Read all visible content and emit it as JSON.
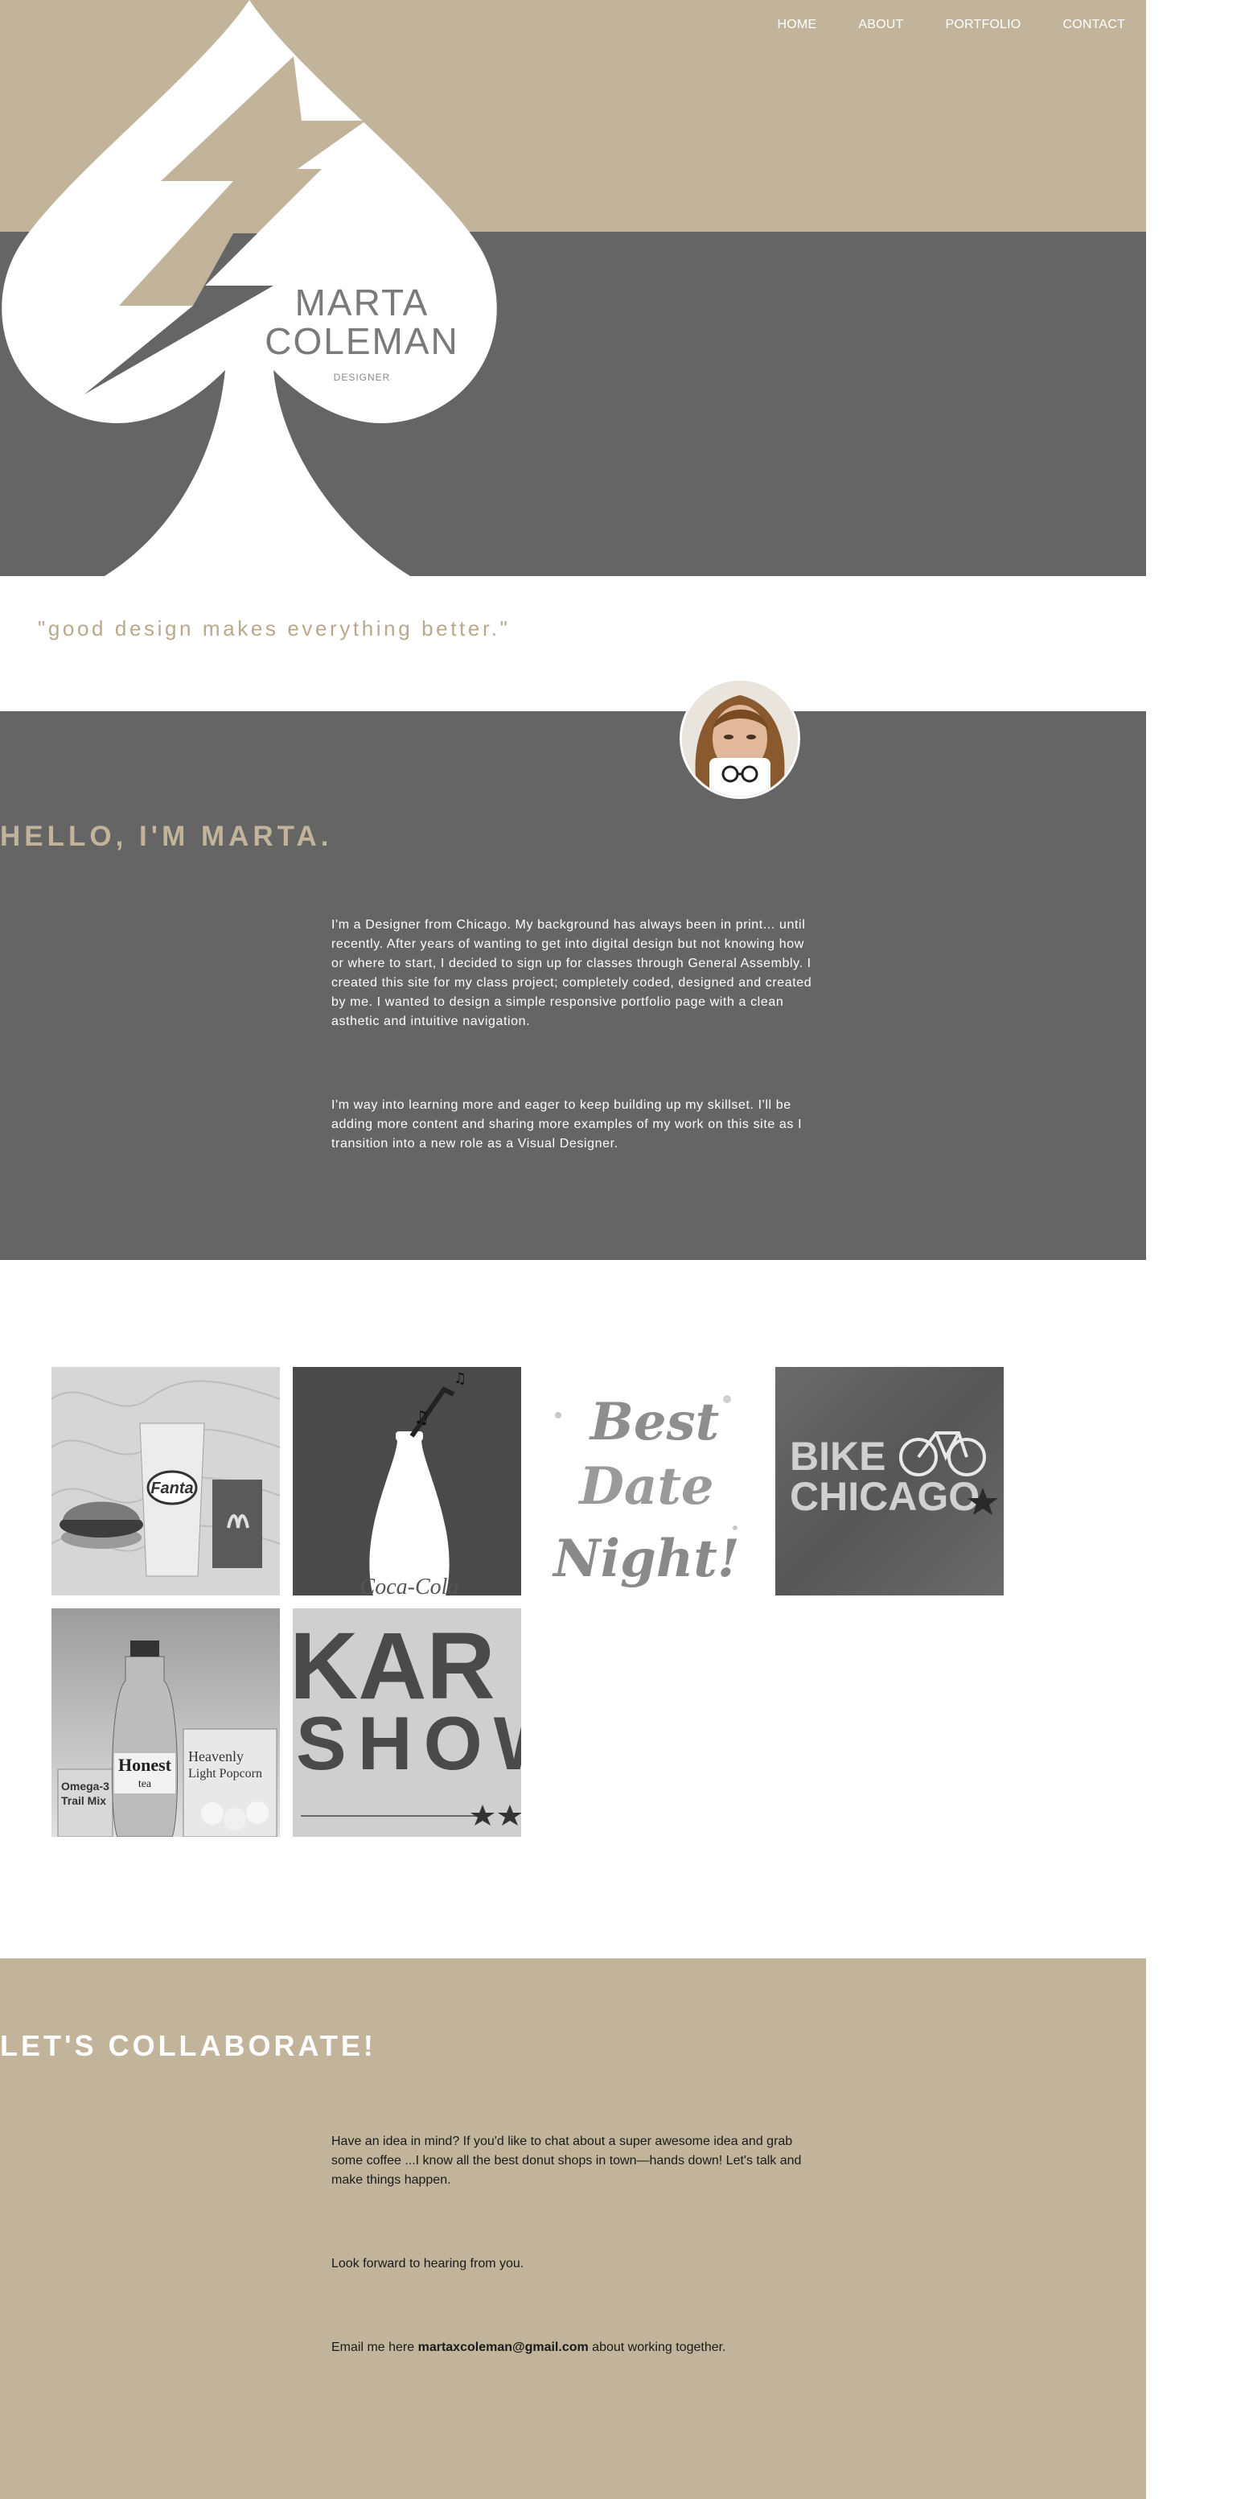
{
  "nav": {
    "items": [
      {
        "label": "HOME"
      },
      {
        "label": "ABOUT"
      },
      {
        "label": "PORTFOLIO"
      },
      {
        "label": "CONTACT"
      }
    ]
  },
  "hero": {
    "name_line1": "MARTA",
    "name_line2": "COLEMAN",
    "role": "DESIGNER",
    "colors": {
      "tan": "#c2b49a",
      "gray": "#656565"
    }
  },
  "quote": "\"good design makes everything better.\"",
  "about": {
    "title": "HELLO, I'M MARTA.",
    "paragraph1": "I'm a Designer from Chicago. My background has always been in print... until recently. After years of wanting to get into digital design but not knowing how or where to start, I decided to sign up for classes through General Assembly. I created this site for my class project; completely coded, designed and created by me. I wanted to design a simple responsive portfolio page with a clean asthetic and intuitive navigation.",
    "paragraph2": "I'm way into learning more and eager to keep building up my skillset. I'll be adding more content and sharing more examples of my work on this site as I transition into a new role as a Visual Designer."
  },
  "portfolio": {
    "tiles": [
      {
        "icon": "fast-food-image",
        "text": "Fanta"
      },
      {
        "icon": "coca-cola-bottle-image",
        "text": "Coca-Cola"
      },
      {
        "icon": "best-date-night-image",
        "text_line1": "Best",
        "text_line2": "Date",
        "text_line3": "Night!"
      },
      {
        "icon": "bike-chicago-image",
        "text_line1": "BIKE",
        "text_line2": "CHICAGO"
      },
      {
        "icon": "snacks-image",
        "text_line1": "Honest",
        "text_line2": "tea",
        "text_line3": "Heavenly",
        "text_line4": "Light Popcorn",
        "text_line5": "Omega-3",
        "text_line6": "Trail Mix"
      },
      {
        "icon": "karaoke-show-image",
        "text_line1": "KAR",
        "text_line2": "SHOW"
      }
    ]
  },
  "contact": {
    "title": "LET'S COLLABORATE!",
    "paragraph1": "Have an idea in mind? If you'd like to chat about a super awesome idea and grab some coffee ...I know all the best donut shops in town—hands down! Let's talk and make things happen.",
    "paragraph2": "Look forward to hearing from you.",
    "email_prefix": "Email me here ",
    "email": "martaxcoleman@gmail.com",
    "email_suffix": " about working together."
  }
}
